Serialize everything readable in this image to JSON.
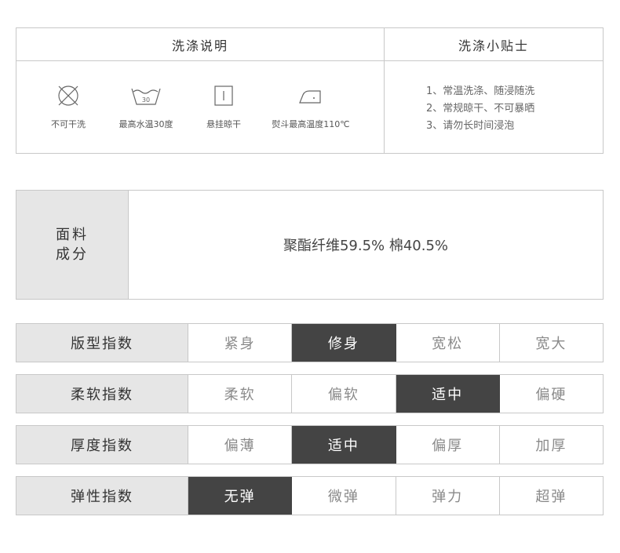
{
  "washing": {
    "header_left": "洗涤说明",
    "header_right": "洗涤小贴士",
    "care_items": [
      {
        "icon": "no-dry-clean-icon",
        "label": "不可干洗"
      },
      {
        "icon": "wash-30-icon",
        "label": "最高水温30度",
        "icon_text": "30"
      },
      {
        "icon": "hang-dry-icon",
        "label": "悬挂晾干"
      },
      {
        "icon": "iron-icon",
        "label": "熨斗最高温度110℃"
      }
    ],
    "tips": [
      "1、常温洗涤、随浸随洗",
      "2、常规晾干、不可暴晒",
      "3、请勿长时间浸泡"
    ]
  },
  "fabric": {
    "label_line1": "面料",
    "label_line2": "成分",
    "value": "聚酯纤维59.5% 棉40.5%"
  },
  "indices": [
    {
      "label": "版型指数",
      "options": [
        "紧身",
        "修身",
        "宽松",
        "宽大"
      ],
      "selected": 1
    },
    {
      "label": "柔软指数",
      "options": [
        "柔软",
        "偏软",
        "适中",
        "偏硬"
      ],
      "selected": 2
    },
    {
      "label": "厚度指数",
      "options": [
        "偏薄",
        "适中",
        "偏厚",
        "加厚"
      ],
      "selected": 1
    },
    {
      "label": "弹性指数",
      "options": [
        "无弹",
        "微弹",
        "弹力",
        "超弹"
      ],
      "selected": 0
    }
  ],
  "colors": {
    "selected_bg": "#444444",
    "label_bg": "#e6e6e6",
    "border": "#c8c8c8"
  }
}
